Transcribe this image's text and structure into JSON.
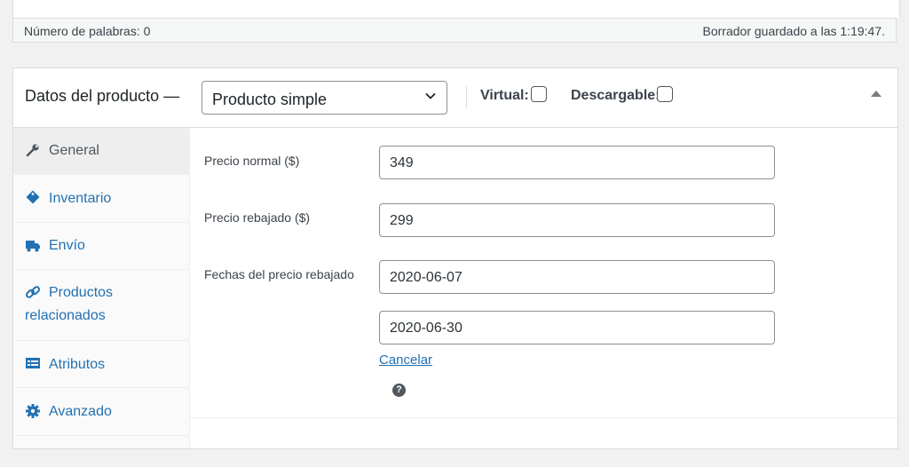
{
  "status_bar": {
    "word_count": "Número de palabras: 0",
    "draft_saved": "Borrador guardado a las 1:19:47."
  },
  "product_data": {
    "title": "Datos del producto —",
    "type_select": {
      "selected": "Producto simple"
    },
    "virtual_label": "Virtual:",
    "virtual_checked": false,
    "downloadable_label": "Descargable:",
    "downloadable_checked": false
  },
  "tabs": [
    {
      "label": "General",
      "icon": "wrench-icon",
      "active": true
    },
    {
      "label": "Inventario",
      "icon": "tag-icon",
      "active": false
    },
    {
      "label": "Envío",
      "icon": "truck-icon",
      "active": false
    },
    {
      "label": "Productos",
      "label2": "relacionados",
      "icon": "link-icon",
      "active": false
    },
    {
      "label": "Atributos",
      "icon": "list-icon",
      "active": false
    },
    {
      "label": "Avanzado",
      "icon": "gear-icon",
      "active": false
    }
  ],
  "general": {
    "regular_price_label": "Precio normal ($)",
    "regular_price_value": "349",
    "sale_price_label": "Precio rebajado ($)",
    "sale_price_value": "299",
    "sale_dates_label": "Fechas del precio rebajado",
    "sale_date_from": "2020-06-07",
    "sale_date_to": "2020-06-30",
    "cancel_label": "Cancelar",
    "help_glyph": "?"
  },
  "colors": {
    "link": "#2271b1",
    "border": "#dcdcde"
  }
}
